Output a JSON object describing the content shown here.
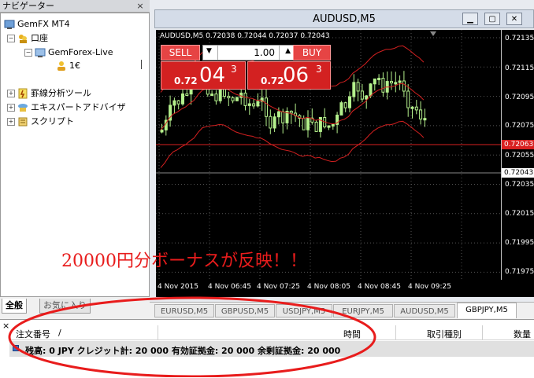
{
  "navigator": {
    "title": "ナビゲーター",
    "close": "×",
    "tree": {
      "root": "GemFX MT4",
      "accounts": "口座",
      "server": "GemForex-Live",
      "account_number": "1€",
      "indicators": "罫線分析ツール",
      "experts": "エキスパートアドバイザ",
      "scripts": "スクリプト"
    },
    "tabs": [
      "全般",
      "お気に入り"
    ]
  },
  "chart": {
    "window_title": "AUDUSD,M5",
    "info_line": "AUDUSD,M5  0.72038 0.72044 0.72037 0.72043",
    "price_labels": [
      "0.72135",
      "0.72115",
      "0.72095",
      "0.72075",
      "0.72055",
      "0.72035",
      "0.72015",
      "0.71995",
      "0.71975"
    ],
    "current_price": "0.72043",
    "line_price": "0.72063",
    "time_labels": [
      "4 Nov 2015",
      "4 Nov 06:45",
      "4 Nov 07:25",
      "4 Nov 08:05",
      "4 Nov 08:45",
      "4 Nov 09:25"
    ],
    "one_click": {
      "sell_label": "SELL",
      "buy_label": "BUY",
      "lot": "1.00",
      "sell_small": "0.72",
      "sell_big": "04",
      "sell_sup": "3",
      "buy_small": "0.72",
      "buy_big": "06",
      "buy_sup": "3"
    }
  },
  "annotation": "20000円分ボーナスが反映！！",
  "symbol_tabs": [
    "EURUSD,M5",
    "GBPUSD,M5",
    "USDJPY,M5",
    "EURJPY,M5",
    "AUDUSD,M5",
    "GBPJPY,M5"
  ],
  "active_symbol_tab": "GBPJPY,M5",
  "terminal": {
    "close": "×",
    "columns": {
      "order": "注文番号",
      "sort_mark": "/",
      "time": "時間",
      "type": "取引種別",
      "volume": "数量"
    },
    "summary": "残高: 0 JPY  クレジット計: 20 000  有効証拠金: 20 000  余剰証拠金: 20 000"
  },
  "colors": {
    "sell_red": "#e64444",
    "price_red": "#d32121",
    "annotation_red": "#e81c1c",
    "candle_up": "#b4f08c",
    "envelope": "#d42020"
  }
}
